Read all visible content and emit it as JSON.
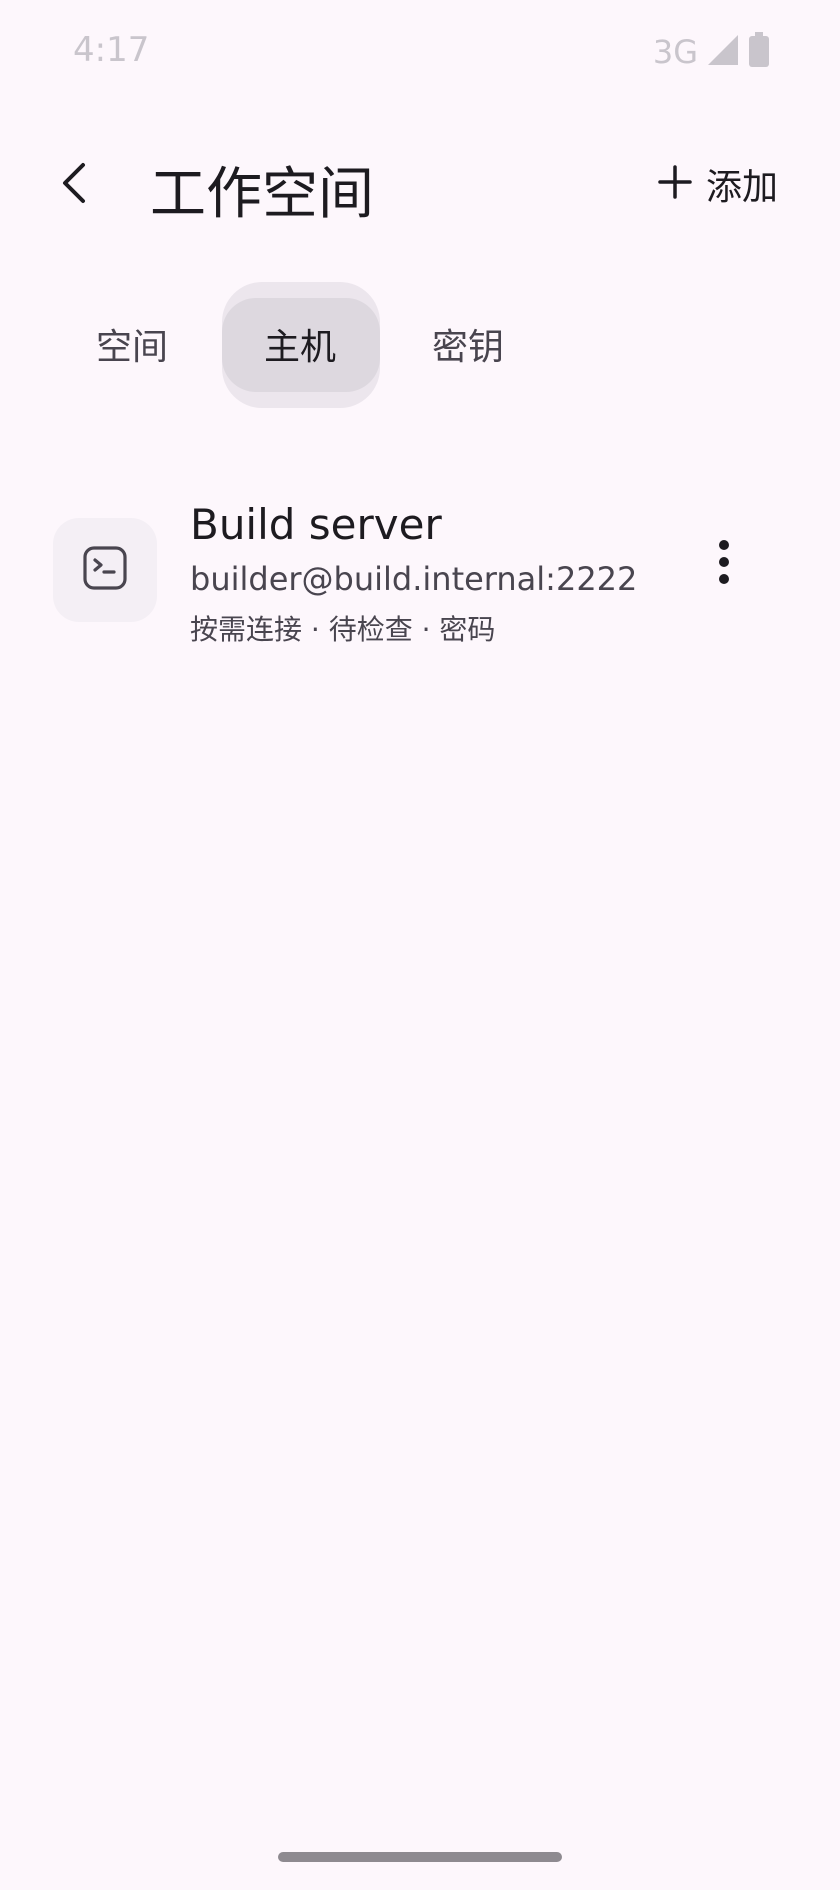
{
  "status_bar": {
    "time": "4:17",
    "network": "3G",
    "signal_icon": "signal-icon",
    "battery_icon": "battery-icon"
  },
  "app_bar": {
    "back_icon": "back-arrow-icon",
    "title": "工作空间",
    "add_icon": "plus-icon",
    "add_label": "添加"
  },
  "tabs": [
    {
      "label": "空间",
      "selected": false
    },
    {
      "label": "主机",
      "selected": true
    },
    {
      "label": "密钥",
      "selected": false
    }
  ],
  "hosts": [
    {
      "icon": "terminal-icon",
      "name": "Build server",
      "address": "builder@build.internal:2222",
      "meta": "按需连接 · 待检查 · 密码",
      "menu_icon": "more-vert-icon"
    }
  ],
  "colors": {
    "background": "#fdf7fc",
    "selected_tab": "#ddd8df",
    "text_primary": "#1d1b20",
    "text_secondary": "#49454f"
  }
}
